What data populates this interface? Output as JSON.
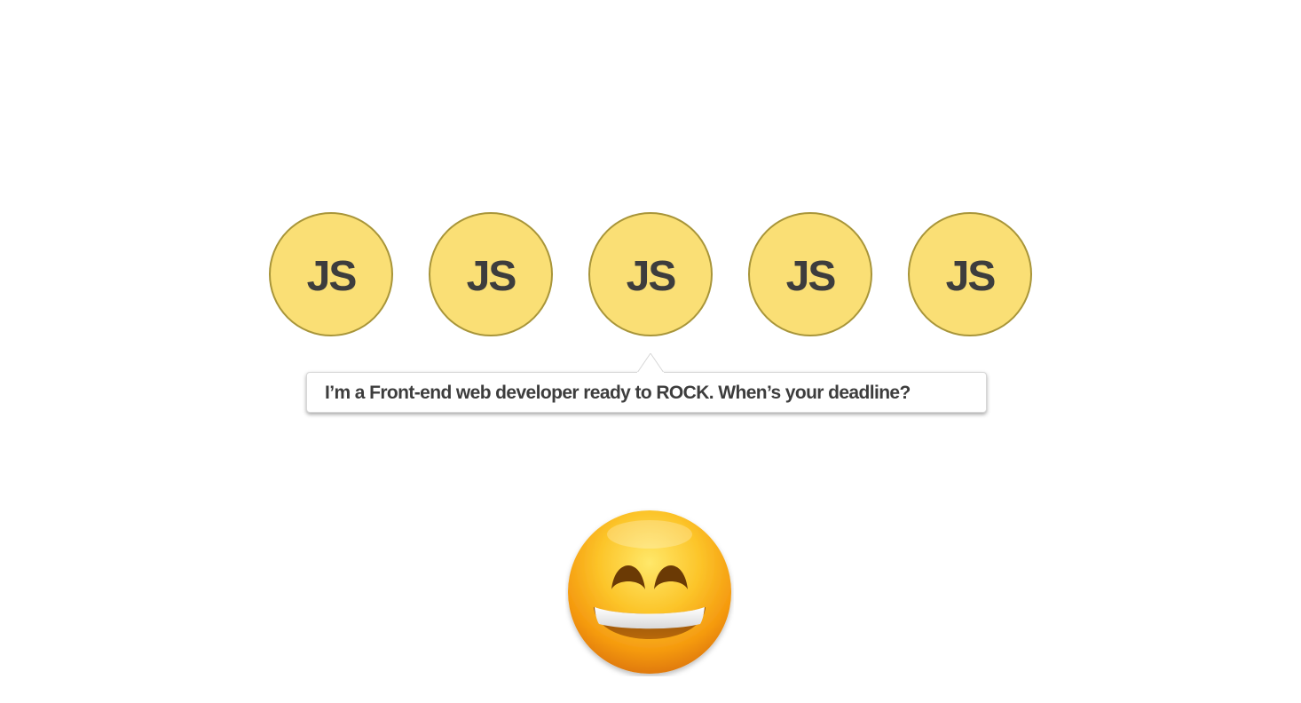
{
  "badges": [
    {
      "label": "JS"
    },
    {
      "label": "JS"
    },
    {
      "label": "JS"
    },
    {
      "label": "JS"
    },
    {
      "label": "JS"
    }
  ],
  "tooltip": {
    "text": "I’m a Front-end web developer ready to ROCK. When’s your deadline?"
  },
  "emoji": {
    "icon": "grinning-face-with-smiling-eyes-icon"
  },
  "colors": {
    "badge_fill": "#fadf75",
    "badge_border": "#a89539",
    "text": "#3d3d3d",
    "background": "#ffffff"
  }
}
